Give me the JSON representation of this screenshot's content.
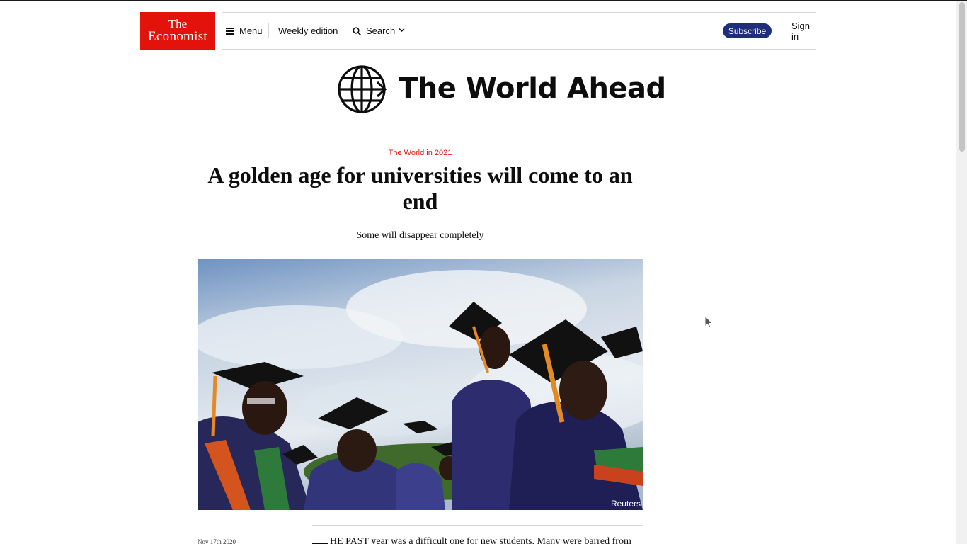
{
  "nav": {
    "logo_line1": "The",
    "logo_line2": "Economist",
    "menu_label": "Menu",
    "weekly_label": "Weekly edition",
    "search_label": "Search",
    "subscribe_label": "Subscribe",
    "signin_label": "Sign in"
  },
  "banner": {
    "title": "The World Ahead"
  },
  "article": {
    "section": "The World in 2021",
    "headline": "A golden age for universities will come to an end",
    "subheadline": "Some will disappear completely",
    "image_credit": "Reuters",
    "date": "Nov 17th 2020",
    "body_start": "HE PAST year was a difficult one for new students. Many were barred from"
  },
  "colors": {
    "brand_red": "#e3120b",
    "subscribe_navy": "#1f2e7a",
    "text": "#0d0d0d"
  },
  "icons": {
    "menu": "hamburger-icon",
    "search": "search-icon",
    "dropdown": "chevron-down-icon",
    "banner": "globe-arrow-icon"
  }
}
